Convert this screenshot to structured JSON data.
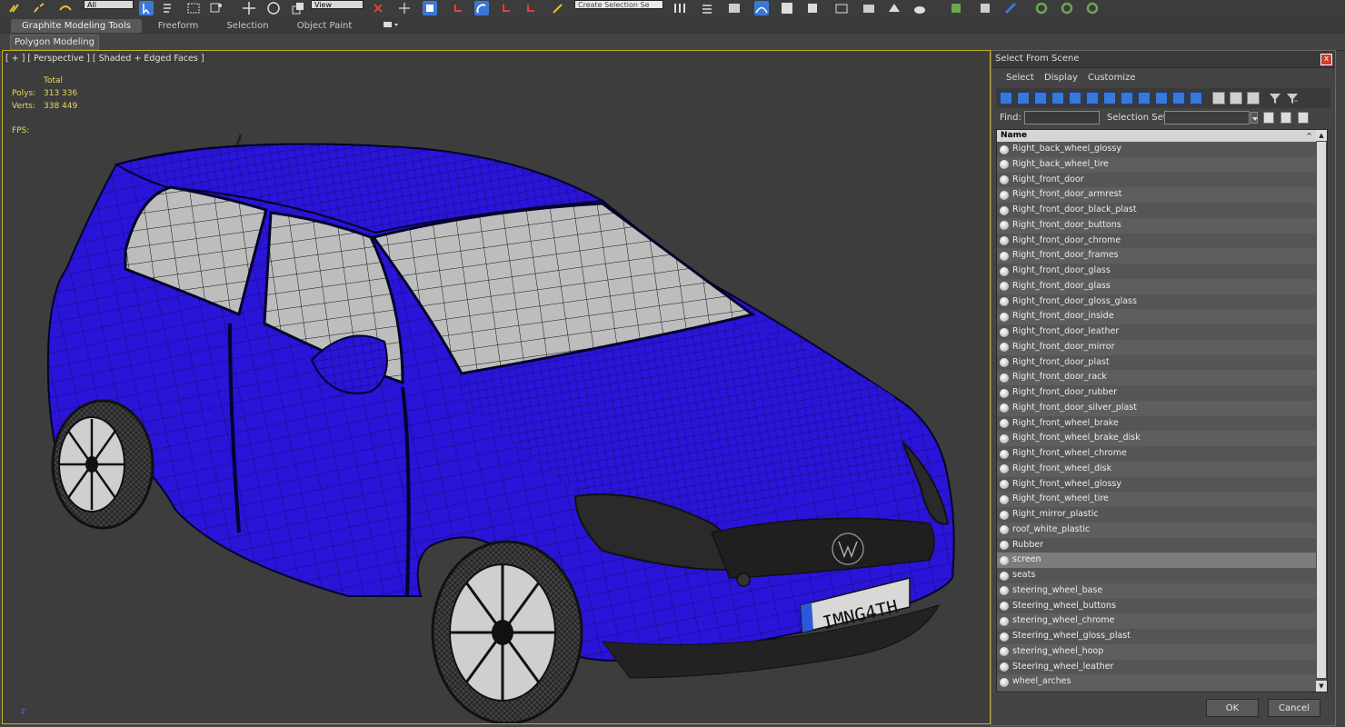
{
  "toolbar": {
    "filter_value": "All",
    "ref_coord": "View",
    "selection_set_placeholder": "Create Selection Se",
    "icons": [
      "link-icon",
      "unlink-icon",
      "bind-space-warp-icon",
      "select-object-icon",
      "select-by-name-icon",
      "rect-region-icon",
      "window-crossing-icon",
      "move-icon",
      "rotate-icon",
      "scale-icon",
      "pivot-icon",
      "select-manipulate-icon",
      "snap-toggle-icon",
      "angle-snap-icon",
      "percent-snap-icon",
      "spinner-snap-icon",
      "edit-named-sel-icon",
      "mirror-icon",
      "align-icon",
      "layer-explorer-icon",
      "scene-explorer-icon",
      "curve-editor-icon",
      "schematic-view-icon",
      "material-editor-icon",
      "render-setup-icon",
      "rendered-frame-icon",
      "render-icon"
    ]
  },
  "ribbon": {
    "tabs": [
      "Graphite Modeling Tools",
      "Freeform",
      "Selection",
      "Object Paint"
    ],
    "active_tab": "Graphite Modeling Tools",
    "panel_tab": "Polygon Modeling"
  },
  "viewport": {
    "label": "[ + ] [ Perspective ] [ Shaded + Edged Faces ]",
    "stats_header": "Total",
    "polys_label": "Polys:",
    "polys_value": "313 336",
    "verts_label": "Verts:",
    "verts_value": "338 449",
    "fps_label": "FPS:",
    "axis": "z",
    "license_plate": "IMNG4TH"
  },
  "dialog": {
    "title": "Select From Scene",
    "close": "x",
    "menu": [
      "Select",
      "Display",
      "Customize"
    ],
    "find_label": "Find:",
    "find_value": "",
    "selection_set_label": "Selection Set:",
    "selection_set_value": "",
    "column_header": "Name",
    "ok": "OK",
    "cancel": "Cancel",
    "selected_item": "screen",
    "items": [
      "Right_back_wheel_glossy",
      "Right_back_wheel_tire",
      "Right_front_door",
      "Right_front_door_armrest",
      "Right_front_door_black_plast",
      "Right_front_door_buttons",
      "Right_front_door_chrome",
      "Right_front_door_frames",
      "Right_front_door_glass",
      "Right_front_door_glass",
      "Right_front_door_gloss_glass",
      "Right_front_door_inside",
      "Right_front_door_leather",
      "Right_front_door_mirror",
      "Right_front_door_plast",
      "Right_front_door_rack",
      "Right_front_door_rubber",
      "Right_front_door_silver_plast",
      "Right_front_wheel_brake",
      "Right_front_wheel_brake_disk",
      "Right_front_wheel_chrome",
      "Right_front_wheel_disk",
      "Right_front_wheel_glossy",
      "Right_front_wheel_tire",
      "Right_mirror_plastic",
      "roof_white_plastic",
      "Rubber",
      "screen",
      "seats",
      "steering_wheel_base",
      "Steering_wheel_buttons",
      "steering_wheel_chrome",
      "Steering_wheel_gloss_plast",
      "steering_wheel_hoop",
      "Steering_wheel_leather",
      "wheel_arches"
    ]
  },
  "colors": {
    "car_body": "#2a14d8",
    "viewport_border": "#c8b020",
    "stats_text": "#e8d85c",
    "close_button": "#d23a2a"
  }
}
